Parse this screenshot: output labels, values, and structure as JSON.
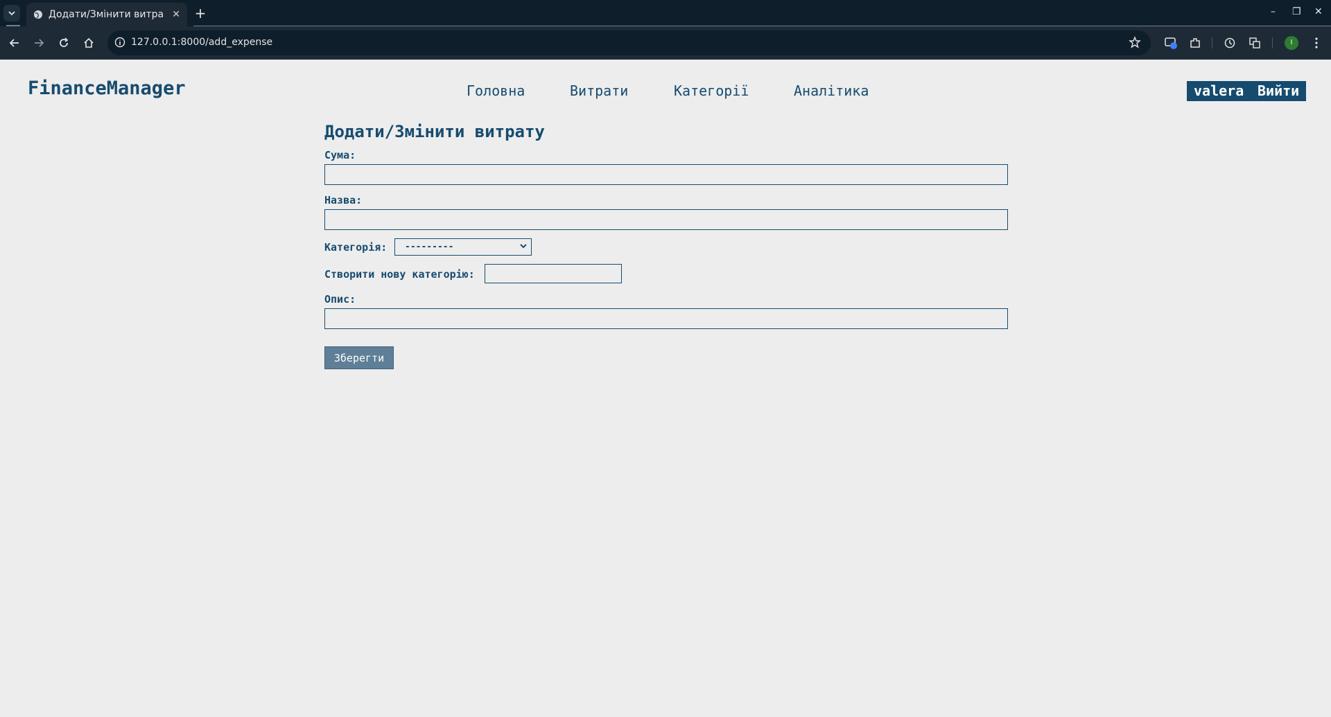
{
  "browser": {
    "tab_title": "Додати/Змінити витрат",
    "tab_close": "✕",
    "new_tab": "+",
    "url": "127.0.0.1:8000/add_expense",
    "profile_initial": "I",
    "window_controls": {
      "minimize": "–",
      "restore": "❐",
      "close": "✕"
    }
  },
  "header": {
    "brand": "FinanceManager",
    "nav": [
      "Головна",
      "Витрати",
      "Категорії",
      "Аналітика"
    ],
    "username": "valera",
    "logout": "Вийти"
  },
  "form": {
    "title": "Додати/Змінити витрату",
    "amount_label": "Сума:",
    "amount_value": "",
    "name_label": "Назва:",
    "name_value": "",
    "category_label": "Категорія:",
    "category_selected": "---------",
    "new_category_label": "Створити нову категорію:",
    "new_category_value": "",
    "description_label": "Опис:",
    "description_value": "",
    "save_label": "Зберегти"
  },
  "colors": {
    "accent": "#164b6f",
    "button": "#5e7f97",
    "background": "#ededed"
  }
}
